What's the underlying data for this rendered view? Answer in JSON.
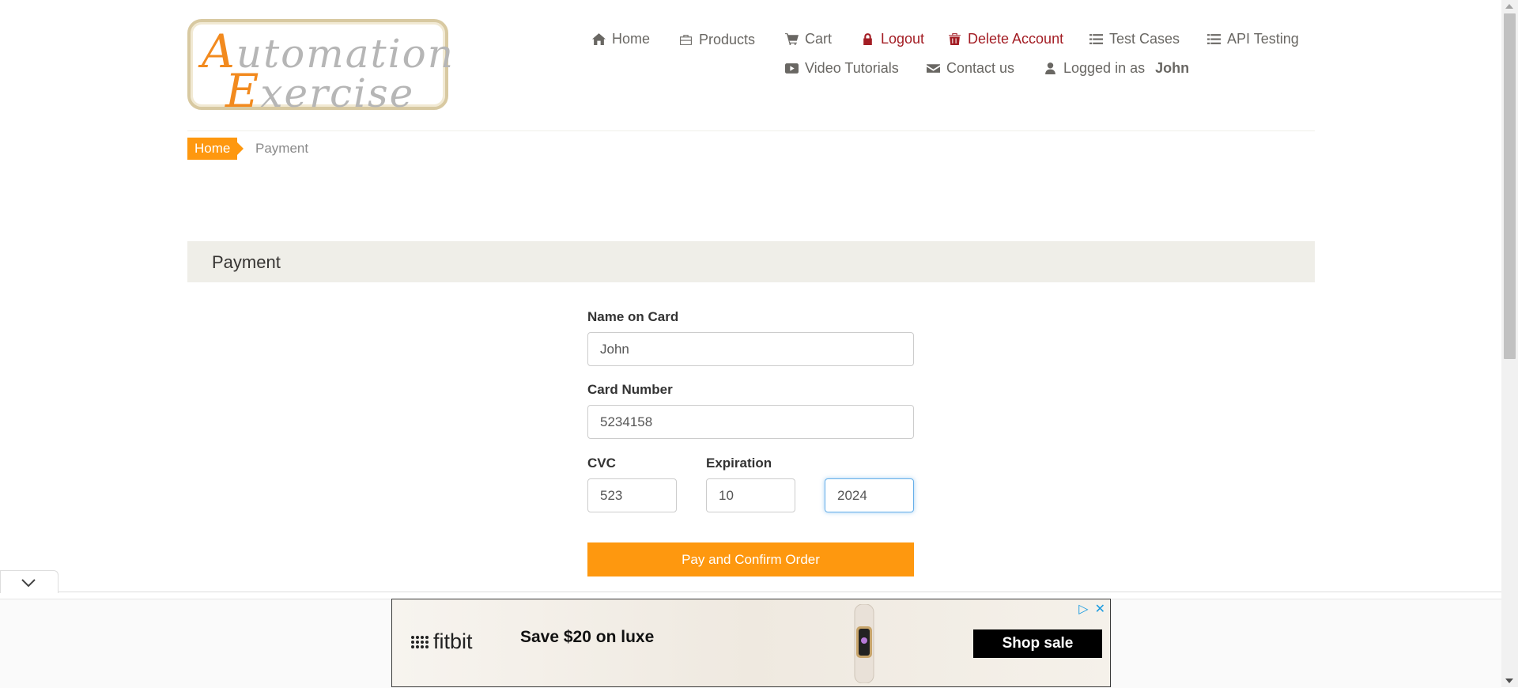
{
  "logo": {
    "line1_cap": "A",
    "line1_rest": "utomation",
    "line2_cap": "E",
    "line2_rest": "xercise"
  },
  "nav": {
    "home": "Home",
    "products": "Products",
    "cart": "Cart",
    "logout": "Logout",
    "delete_account": "Delete Account",
    "test_cases": "Test Cases",
    "api_testing": "API Testing",
    "video_tutorials": "Video Tutorials",
    "contact_us": "Contact us",
    "logged_in_prefix": "Logged in as",
    "logged_in_user": "John"
  },
  "breadcrumb": {
    "home": "Home",
    "current": "Payment"
  },
  "payment": {
    "heading": "Payment",
    "name_label": "Name on Card",
    "name_value": "John",
    "card_label": "Card Number",
    "card_value": "5234158",
    "cvc_label": "CVC",
    "cvc_value": "523",
    "expiration_label": "Expiration",
    "exp_month_value": "10",
    "exp_year_value": "2024",
    "submit_label": "Pay and Confirm Order"
  },
  "ad": {
    "brand": "fitbit",
    "headline": "Save $20 on luxe",
    "cta": "Shop sale",
    "close": "✕",
    "info": "▷"
  },
  "colors": {
    "accent": "#fe980f",
    "danger": "#a31d24",
    "text": "#696763"
  }
}
